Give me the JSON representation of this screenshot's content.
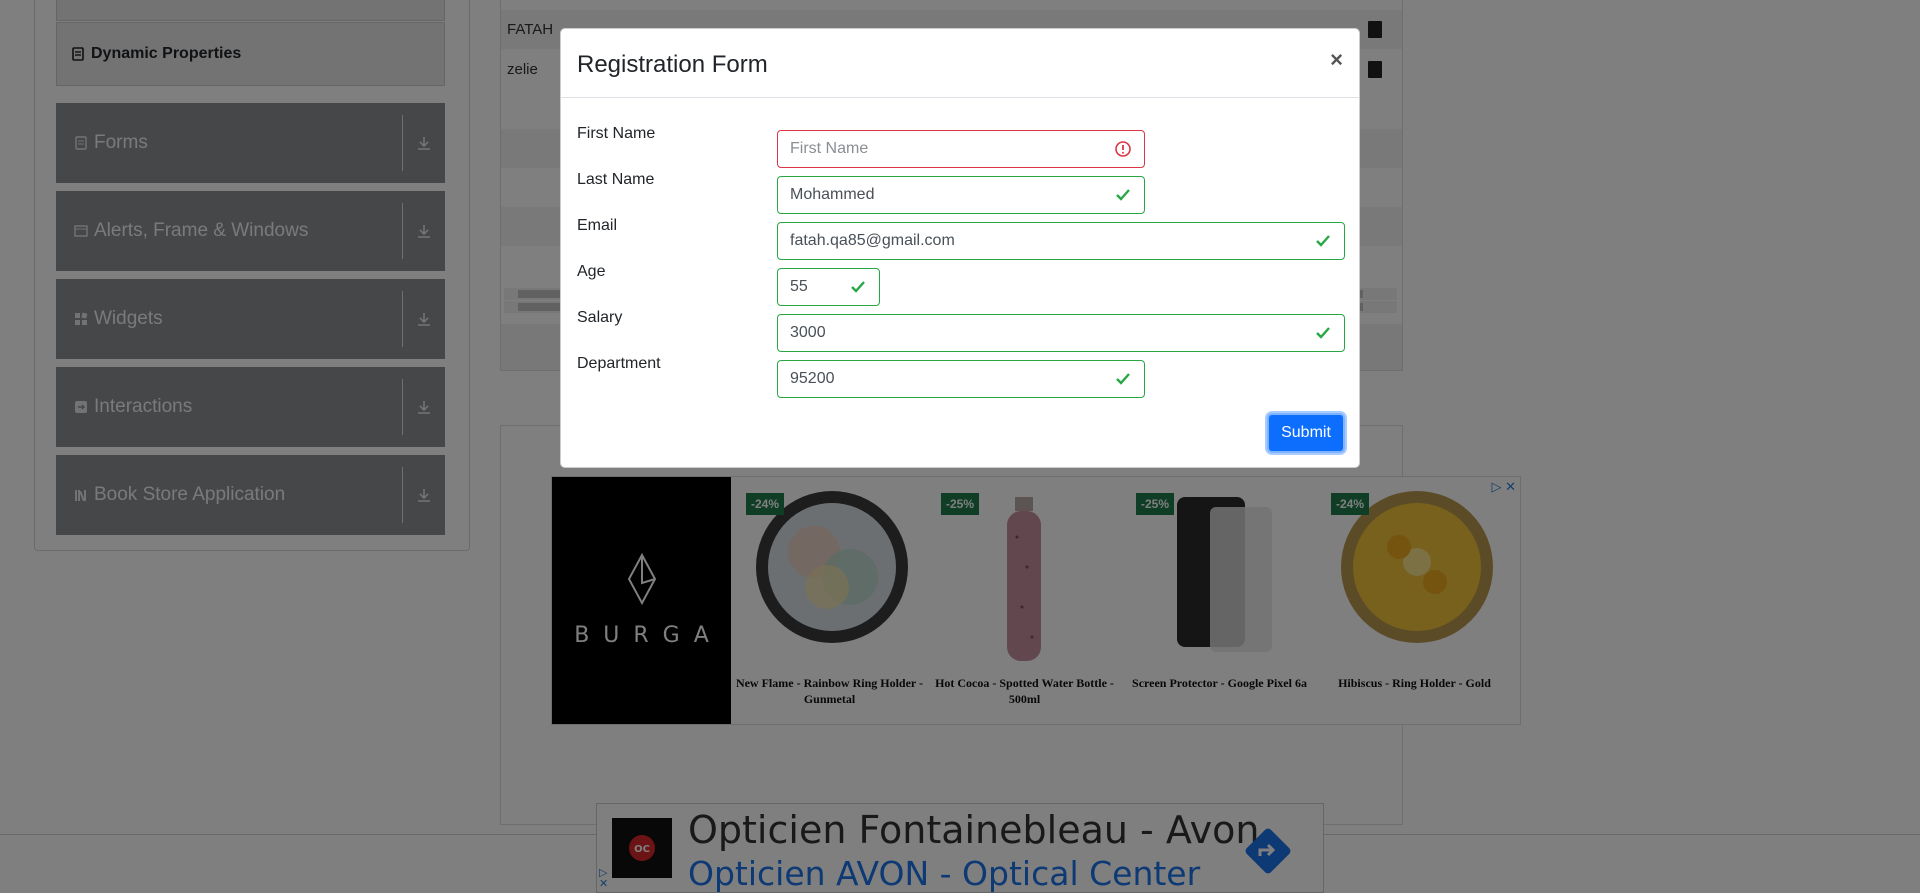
{
  "sidebar": {
    "active_item": {
      "label": "Dynamic Properties",
      "icon": "file-icon"
    },
    "categories": [
      {
        "label": "Forms",
        "icon": "form-icon"
      },
      {
        "label": "Alerts, Frame & Windows",
        "icon": "window-icon"
      },
      {
        "label": "Widgets",
        "icon": "widgets-icon"
      },
      {
        "label": "Interactions",
        "icon": "interactions-icon"
      },
      {
        "label": "Book Store Application",
        "icon": "books-icon"
      }
    ]
  },
  "table": {
    "rows": [
      {
        "first_name": "FATAH"
      },
      {
        "first_name": "zelie"
      }
    ]
  },
  "product_ad": {
    "brand": "BURGA",
    "products": [
      {
        "discount": "-24%",
        "name": "New Flame - Rainbow Ring Holder - Gunmetal"
      },
      {
        "discount": "-25%",
        "name": "Hot Cocoa - Spotted Water Bottle - 500ml"
      },
      {
        "discount": "-25%",
        "name": "Screen Protector - Google Pixel 6a"
      },
      {
        "discount": "-24%",
        "name": "Hibiscus - Ring Holder - Gold"
      }
    ]
  },
  "bottom_ad": {
    "headline": "Opticien Fontainebleau - Avon",
    "subline": "Opticien AVON - Optical Center"
  },
  "modal": {
    "title": "Registration Form",
    "close_label": "×",
    "fields": {
      "first_name": {
        "label": "First Name",
        "value": "",
        "placeholder": "First Name",
        "state": "invalid"
      },
      "last_name": {
        "label": "Last Name",
        "value": "Mohammed",
        "state": "valid"
      },
      "email": {
        "label": "Email",
        "value": "fatah.qa85@gmail.com",
        "state": "valid"
      },
      "age": {
        "label": "Age",
        "value": "55",
        "state": "valid"
      },
      "salary": {
        "label": "Salary",
        "value": "3000",
        "state": "valid"
      },
      "department": {
        "label": "Department",
        "value": "95200",
        "state": "valid"
      }
    },
    "submit_label": "Submit"
  },
  "colors": {
    "valid": "#28a745",
    "invalid": "#dc3545",
    "primary": "#0d6efd",
    "sidebar_category_bg": "#8b8e93"
  }
}
